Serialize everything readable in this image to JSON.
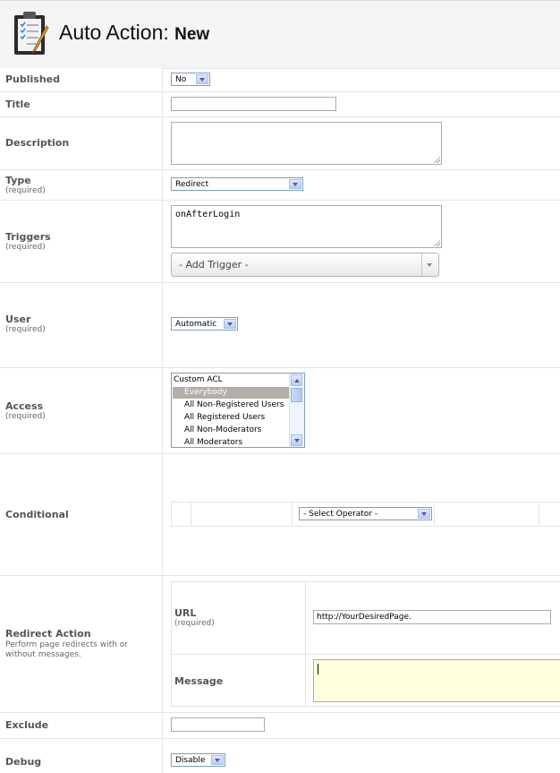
{
  "header": {
    "title": "Auto Action:",
    "subtitle": "New",
    "icon": "clipboard-checklist-icon"
  },
  "fields": {
    "published": {
      "label": "Published",
      "value": "No"
    },
    "title": {
      "label": "Title",
      "value": ""
    },
    "description": {
      "label": "Description",
      "value": ""
    },
    "type": {
      "label": "Type",
      "required": "(required)",
      "value": "Redirect"
    },
    "triggers": {
      "label": "Triggers",
      "required": "(required)",
      "value": "onAfterLogin",
      "add_trigger": "- Add Trigger -"
    },
    "user": {
      "label": "User",
      "required": "(required)",
      "value": "Automatic"
    },
    "access": {
      "label": "Access",
      "required": "(required)",
      "options": [
        "Custom ACL",
        "Everybody",
        "All Non-Registered Users",
        "All Registered Users",
        "All Non-Moderators",
        "All Moderators"
      ],
      "selected": "Everybody"
    },
    "conditional": {
      "label": "Conditional",
      "operator": "- Select Operator -"
    },
    "redirect_action": {
      "label": "Redirect Action",
      "desc_line1": "Perform page redirects with or",
      "desc_line2": "without messages.",
      "url_label": "URL",
      "url_required": "(required)",
      "url_value": "http://YourDesiredPage.",
      "message_label": "Message",
      "message_value": ""
    },
    "exclude": {
      "label": "Exclude",
      "value": ""
    },
    "debug": {
      "label": "Debug",
      "value": "Disable"
    }
  },
  "colors": {
    "highlight": "#b3aea6",
    "message_bg": "#ffffdd"
  }
}
